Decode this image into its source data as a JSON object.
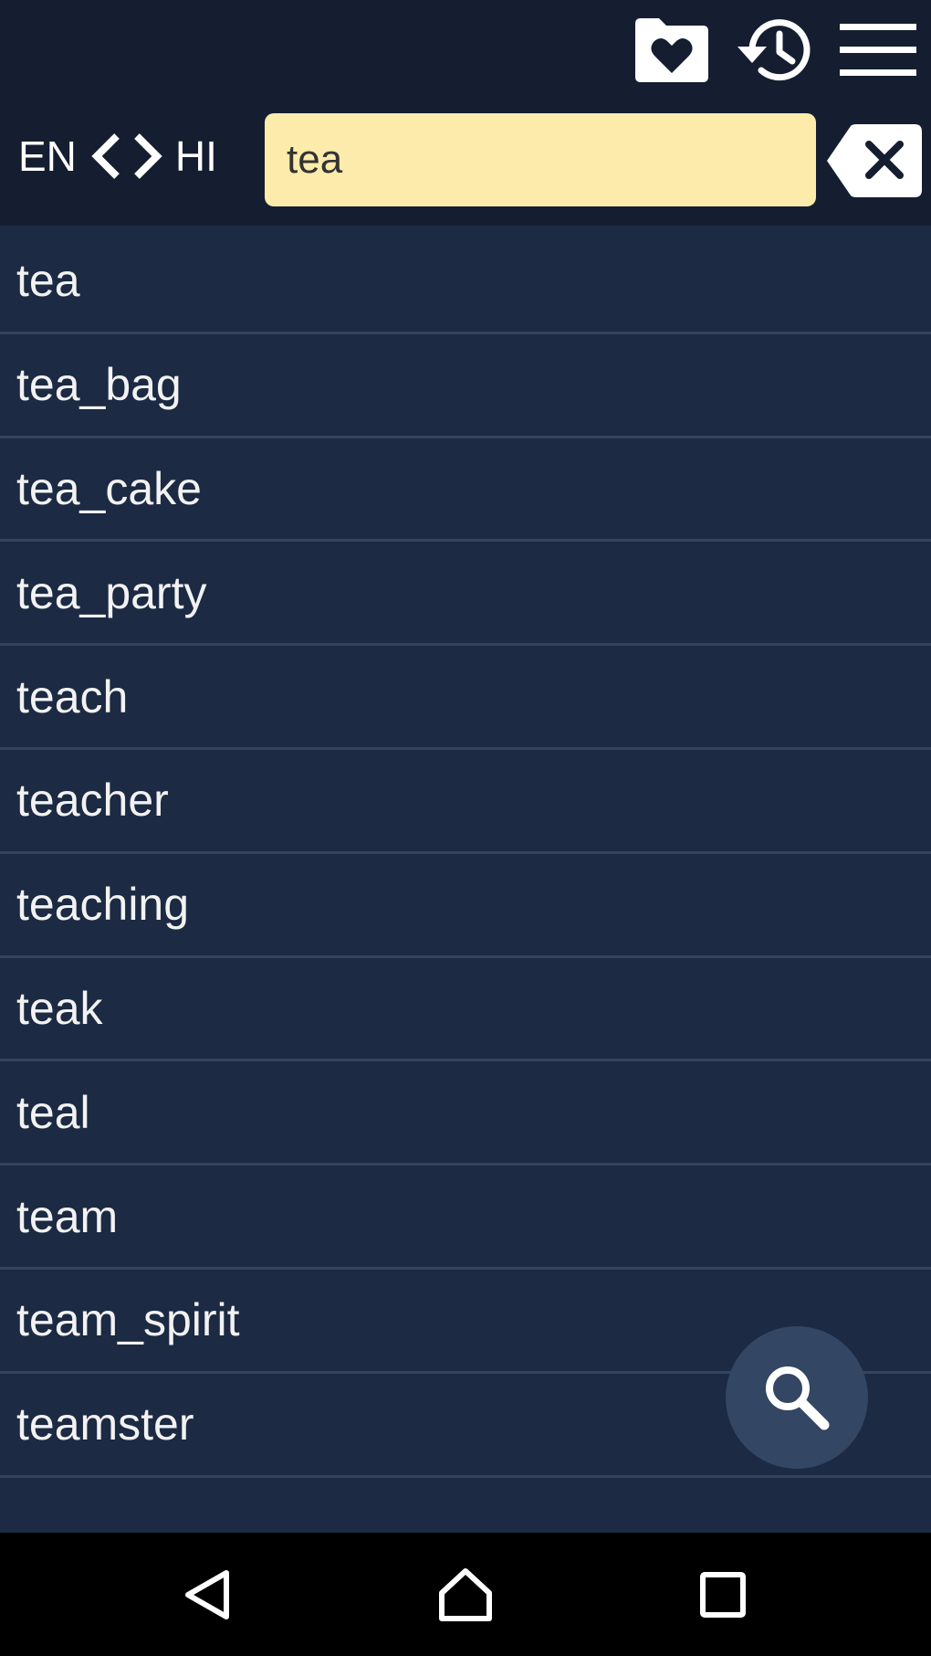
{
  "toolbar": {
    "icons": {
      "favorites": "folder-heart-icon",
      "history": "history-icon",
      "menu": "hamburger-menu-icon"
    }
  },
  "language_switch": {
    "source": "EN",
    "target": "HI"
  },
  "search": {
    "value": "tea",
    "clear_icon": "backspace-clear-icon"
  },
  "words": [
    "tea",
    "tea_bag",
    "tea_cake",
    "tea_party",
    "teach",
    "teacher",
    "teaching",
    "teak",
    "teal",
    "team",
    "team_spirit",
    "teamster"
  ],
  "fab": {
    "icon": "search-icon"
  },
  "nav": {
    "icons": [
      "back-icon",
      "home-icon",
      "recents-icon"
    ]
  },
  "colors": {
    "header_bg": "#141e30",
    "list_bg": "#1c2a43",
    "divider": "#34445f",
    "search_field_bg": "#fcebaa",
    "fab_bg": "#334663"
  }
}
